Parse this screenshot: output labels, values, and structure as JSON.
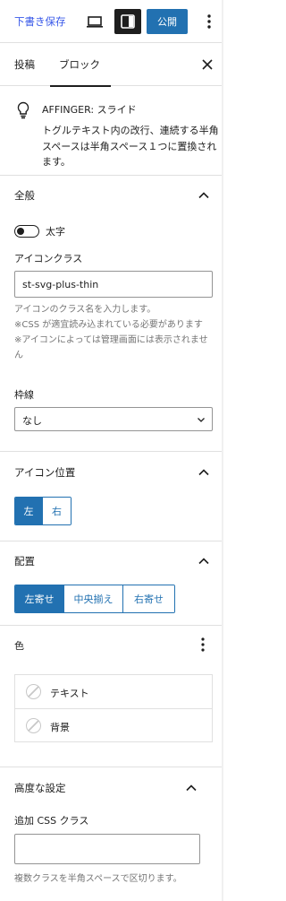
{
  "topbar": {
    "draft_label": "下書き保存",
    "publish_label": "公開",
    "icons": [
      "desktop-preview-icon",
      "sidebar-toggle-icon",
      "more-vertical-icon"
    ]
  },
  "tabs": {
    "post": "投稿",
    "block": "ブロック",
    "active": "block"
  },
  "block_card": {
    "icon": "lightbulb-icon",
    "title": "AFFINGER: スライド",
    "description": "トグルテキスト内の改行、連続する半角スペースは半角スペース１つに置換されます。"
  },
  "general_panel": {
    "title": "全般",
    "bold_toggle_label": "太字",
    "bold_toggle_on": false,
    "icon_class_label": "アイコンクラス",
    "icon_class_value": "st-svg-plus-thin",
    "icon_class_help": [
      "アイコンのクラス名を入力します。",
      "※CSS が適宜読み込まれている必要があります",
      "※アイコンによっては管理画面には表示されません"
    ],
    "border_label": "枠線",
    "border_value": "なし"
  },
  "icon_position_panel": {
    "title": "アイコン位置",
    "options": [
      "左",
      "右"
    ],
    "selected": "左"
  },
  "alignment_panel": {
    "title": "配置",
    "options": [
      "左寄せ",
      "中央揃え",
      "右寄せ"
    ],
    "selected": "左寄せ"
  },
  "color_panel": {
    "title": "色",
    "items": [
      {
        "label": "テキスト"
      },
      {
        "label": "背景"
      }
    ]
  },
  "advanced_panel": {
    "title": "高度な設定",
    "css_class_label": "追加 CSS クラス",
    "css_class_value": "",
    "css_class_help": "複数クラスを半角スペースで区切ります。"
  },
  "colors": {
    "accent": "#2271b1",
    "draft_link": "#3858e9",
    "dark": "#1e1e1e",
    "border": "#e0e0e0"
  }
}
